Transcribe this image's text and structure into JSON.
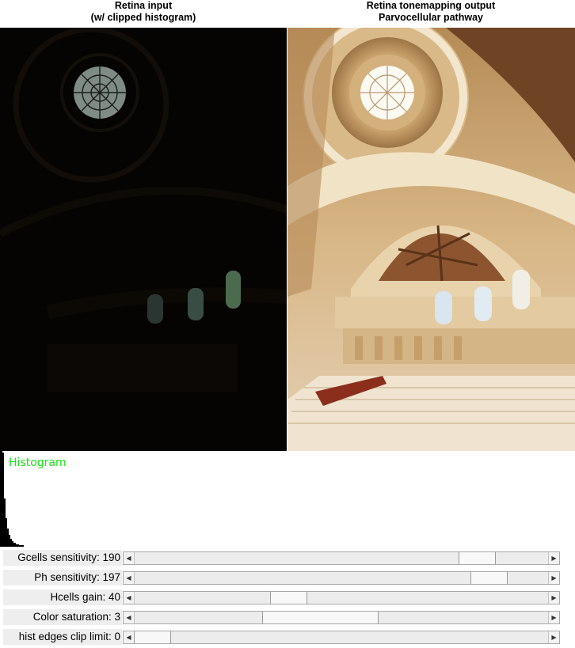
{
  "titles": {
    "left_line1": "Retina input",
    "left_line2": "(w/ clipped histogram)",
    "right_line1": "Retina tonemapping output",
    "right_line2": "Parvocellular pathway"
  },
  "histogram": {
    "label": "Histogram",
    "label_color": "#14e614"
  },
  "trackbars": [
    {
      "label": "Gcells sensitivity: 190",
      "position_fraction": 0.86,
      "thumb_fraction": 0.09
    },
    {
      "label": "Ph sensitivity: 197",
      "position_fraction": 0.89,
      "thumb_fraction": 0.09
    },
    {
      "label": "Hcells gain:  40",
      "position_fraction": 0.36,
      "thumb_fraction": 0.09
    },
    {
      "label": "Color saturation: 3",
      "position_fraction": 0.43,
      "thumb_fraction": 0.28
    },
    {
      "label": "hist edges clip limit:  0",
      "position_fraction": 0.0,
      "thumb_fraction": 0.09
    }
  ],
  "icons": {
    "scroll_left": "arrow-left-icon",
    "scroll_right": "arrow-right-icon"
  },
  "colors": {
    "label_bg": "#eeeeee",
    "input_panel_bg": "#070503",
    "output_panel_tone": "#c9a574"
  }
}
